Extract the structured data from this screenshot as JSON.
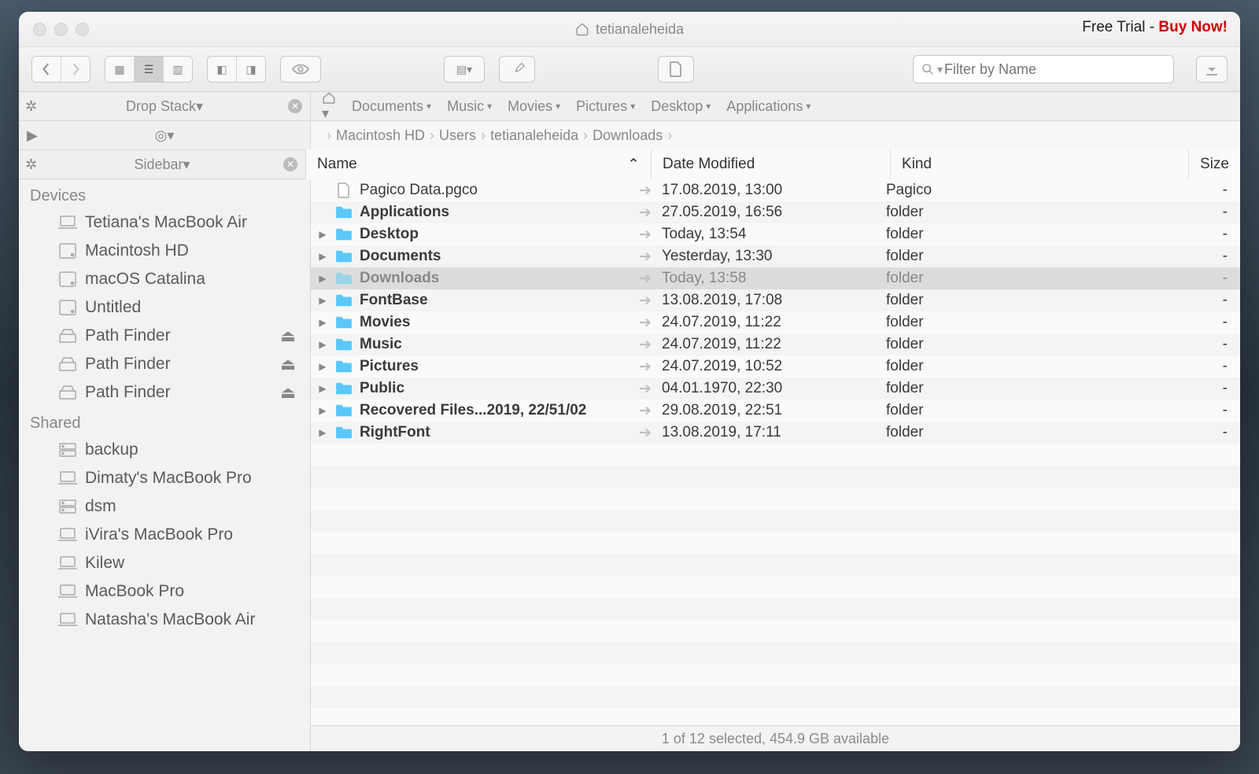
{
  "trial": {
    "text": "Free Trial - ",
    "link": "Buy Now!"
  },
  "window_title": "tetianaleheida",
  "search_placeholder": "Filter by Name",
  "shelf": {
    "drop_stack": "Drop Stack",
    "sidebar_label": "Sidebar"
  },
  "favorites": [
    "Documents",
    "Music",
    "Movies",
    "Pictures",
    "Desktop",
    "Applications"
  ],
  "breadcrumbs": [
    "Macintosh HD",
    "Users",
    "tetianaleheida",
    "Downloads"
  ],
  "columns": {
    "name": "Name",
    "date": "Date Modified",
    "kind": "Kind",
    "size": "Size"
  },
  "sidebar": {
    "devices_header": "Devices",
    "devices": [
      {
        "icon": "laptop",
        "label": "Tetiana's MacBook Air"
      },
      {
        "icon": "hdd",
        "label": "Macintosh HD"
      },
      {
        "icon": "hdd",
        "label": "macOS Catalina"
      },
      {
        "icon": "hdd",
        "label": "Untitled"
      },
      {
        "icon": "disk",
        "label": "Path Finder",
        "eject": true
      },
      {
        "icon": "disk",
        "label": "Path Finder",
        "eject": true
      },
      {
        "icon": "disk",
        "label": "Path Finder",
        "eject": true
      }
    ],
    "shared_header": "Shared",
    "shared": [
      {
        "icon": "server",
        "label": "backup"
      },
      {
        "icon": "laptop",
        "label": "Dimaty's MacBook Pro"
      },
      {
        "icon": "server",
        "label": "dsm"
      },
      {
        "icon": "laptop",
        "label": "iVira's MacBook Pro"
      },
      {
        "icon": "laptop",
        "label": "Kilew"
      },
      {
        "icon": "laptop",
        "label": "MacBook Pro"
      },
      {
        "icon": "laptop",
        "label": "Natasha's MacBook Air"
      }
    ]
  },
  "files": [
    {
      "expand": false,
      "icon": "doc",
      "name": "Pagico Data.pgco",
      "bold": false,
      "date": "17.08.2019, 13:00",
      "kind": "Pagico",
      "size": "-",
      "selected": false
    },
    {
      "expand": false,
      "icon": "appfolder",
      "name": "Applications",
      "bold": true,
      "date": "27.05.2019, 16:56",
      "kind": "folder",
      "size": "-",
      "selected": false
    },
    {
      "expand": true,
      "icon": "folder",
      "name": "Desktop",
      "bold": true,
      "date": "Today, 13:54",
      "kind": "folder",
      "size": "-",
      "selected": false
    },
    {
      "expand": true,
      "icon": "folder",
      "name": "Documents",
      "bold": true,
      "date": "Yesterday, 13:30",
      "kind": "folder",
      "size": "-",
      "selected": false
    },
    {
      "expand": true,
      "icon": "folder",
      "name": "Downloads",
      "bold": true,
      "date": "Today, 13:58",
      "kind": "folder",
      "size": "-",
      "selected": true
    },
    {
      "expand": true,
      "icon": "folder",
      "name": "FontBase",
      "bold": true,
      "date": "13.08.2019, 17:08",
      "kind": "folder",
      "size": "-",
      "selected": false
    },
    {
      "expand": true,
      "icon": "folder",
      "name": "Movies",
      "bold": true,
      "date": "24.07.2019, 11:22",
      "kind": "folder",
      "size": "-",
      "selected": false
    },
    {
      "expand": true,
      "icon": "folder",
      "name": "Music",
      "bold": true,
      "date": "24.07.2019, 11:22",
      "kind": "folder",
      "size": "-",
      "selected": false
    },
    {
      "expand": true,
      "icon": "folder",
      "name": "Pictures",
      "bold": true,
      "date": "24.07.2019, 10:52",
      "kind": "folder",
      "size": "-",
      "selected": false
    },
    {
      "expand": true,
      "icon": "folder",
      "name": "Public",
      "bold": true,
      "date": "04.01.1970, 22:30",
      "kind": "folder",
      "size": "-",
      "selected": false
    },
    {
      "expand": true,
      "icon": "folder",
      "name": "Recovered Files...2019, 22/51/02",
      "bold": true,
      "date": "29.08.2019, 22:51",
      "kind": "folder",
      "size": "-",
      "selected": false
    },
    {
      "expand": true,
      "icon": "folder",
      "name": "RightFont",
      "bold": true,
      "date": "13.08.2019, 17:11",
      "kind": "folder",
      "size": "-",
      "selected": false
    }
  ],
  "status": "1 of 12 selected, 454.9 GB available"
}
